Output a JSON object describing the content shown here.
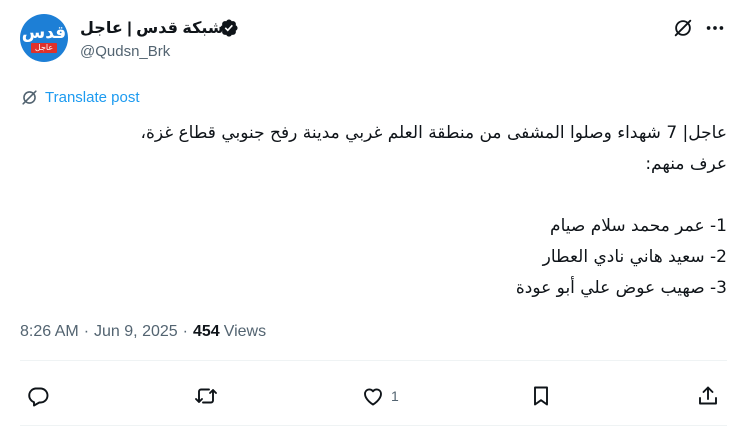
{
  "author": {
    "display_name": "شبكة قدس | عاجل",
    "handle": "@Qudsn_Brk",
    "avatar_logo_text": "قدس",
    "avatar_badge_text": "عاجل",
    "verified": true
  },
  "translate_label": "Translate post",
  "tweet_lines": [
    "عاجل| 7 شهداء وصلوا المشفى من منطقة العلم غربي مدينة رفح جنوبي قطاع غزة،",
    "عرف منهم:",
    "",
    "1- عمر محمد سلام صيام",
    "2- سعيد هاني نادي العطار",
    "3- صهيب عوض علي أبو عودة"
  ],
  "meta": {
    "time": "8:26 AM",
    "date": "Jun 9, 2025",
    "views_count": "454",
    "views_label": "Views"
  },
  "actions": {
    "reply_count": "",
    "repost_count": "",
    "like_count": "1"
  },
  "colors": {
    "link": "#1d9bf0",
    "secondary_text": "#536471",
    "avatar_bg": "#1d7fd6",
    "badge_red": "#e0312b"
  },
  "icons": [
    "verified-badge-icon",
    "grok-icon",
    "more-icon",
    "translate-icon",
    "reply-icon",
    "repost-icon",
    "like-icon",
    "bookmark-icon",
    "share-icon"
  ]
}
